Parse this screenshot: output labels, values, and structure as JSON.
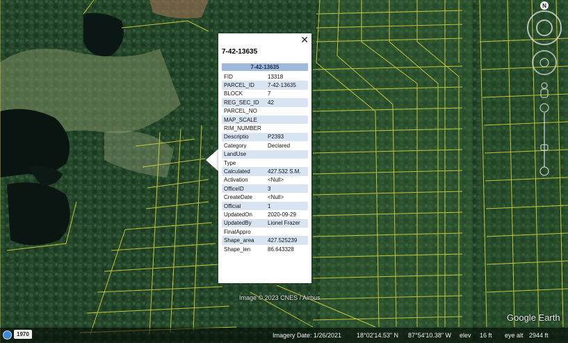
{
  "popup": {
    "close_label": "✕",
    "title": "7-42-13635",
    "table_header": "7-42-13635",
    "rows": [
      {
        "key": "FID",
        "value": "13318"
      },
      {
        "key": "PARCEL_ID",
        "value": "7-42-13635"
      },
      {
        "key": "BLOCK",
        "value": "7"
      },
      {
        "key": "REG_SEC_ID",
        "value": "42"
      },
      {
        "key": "PARCEL_NO",
        "value": ""
      },
      {
        "key": "MAP_SCALE",
        "value": ""
      },
      {
        "key": "RIM_NUMBER",
        "value": ""
      },
      {
        "key": "Descriptio",
        "value": "P2393"
      },
      {
        "key": "Category",
        "value": "Declared"
      },
      {
        "key": "LandUse",
        "value": ""
      },
      {
        "key": "Type",
        "value": ""
      },
      {
        "key": "Calculated",
        "value": "427.532 S.M."
      },
      {
        "key": "Activation",
        "value": "<Null>"
      },
      {
        "key": "OfficeID",
        "value": "3"
      },
      {
        "key": "CreateDate",
        "value": "<Null>"
      },
      {
        "key": "Official",
        "value": "1"
      },
      {
        "key": "UpdatedOn",
        "value": "2020-09-29"
      },
      {
        "key": "UpdatedBy",
        "value": "Lionel Frazer"
      },
      {
        "key": "FinalAppro",
        "value": ""
      },
      {
        "key": "Shape_area",
        "value": "427.525239"
      },
      {
        "key": "Shape_len",
        "value": "86.643328"
      }
    ]
  },
  "map": {
    "credit": "Image © 2023 CNES / Airbus",
    "logo": "Google Earth",
    "compass_label": "N",
    "parcel_line_color": "#d6d23a"
  },
  "statusbar": {
    "year": "1970",
    "imagery_date": "Imagery Date: 1/26/2021",
    "lat": "18°02'14.53\" N",
    "lon": "87°54'10.38\" W",
    "elev_label": "elev",
    "elev_value": "16 ft",
    "eye_alt_label": "eye alt",
    "eye_alt_value": "2944 ft"
  }
}
